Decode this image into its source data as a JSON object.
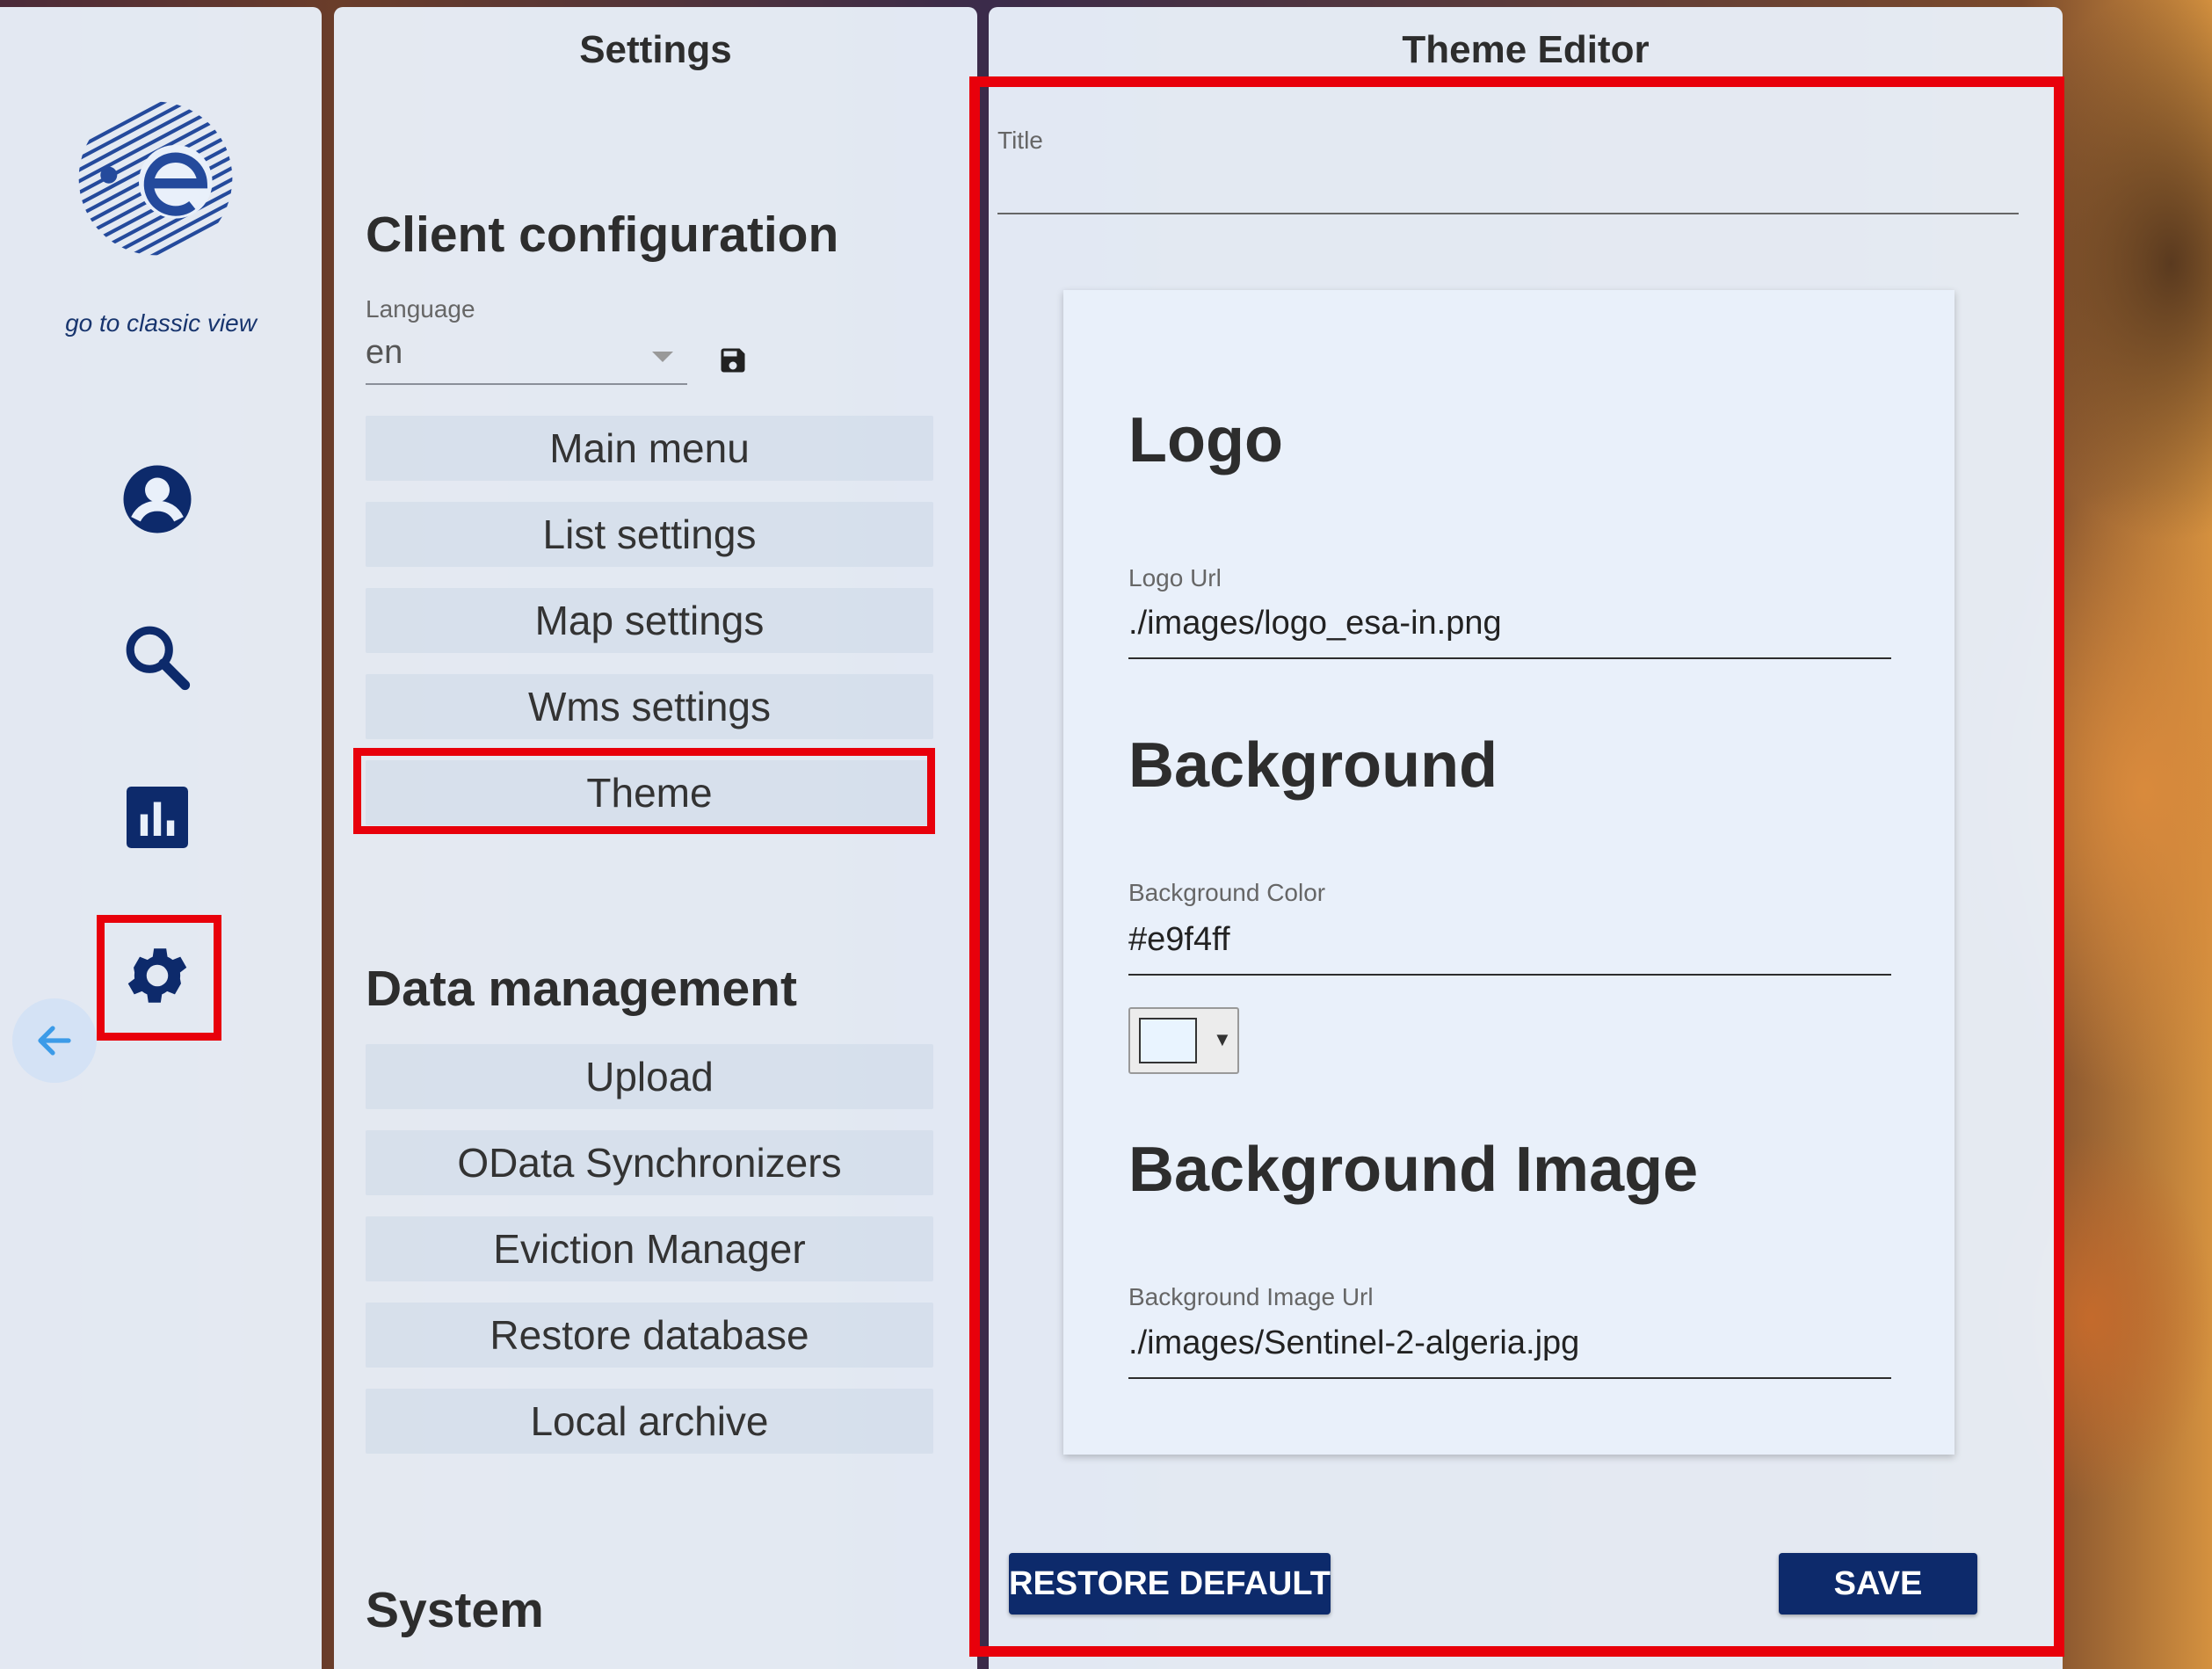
{
  "rail": {
    "classic_link": "go to classic view",
    "icons": [
      "esa-logo",
      "user-icon",
      "search-icon",
      "chart-icon",
      "gear-icon",
      "arrow-left-icon"
    ]
  },
  "settings": {
    "title": "Settings",
    "client_configuration": {
      "heading": "Client configuration",
      "language_label": "Language",
      "language_value": "en",
      "items": [
        "Main menu",
        "List settings",
        "Map settings",
        "Wms settings",
        "Theme"
      ],
      "selected": "Theme"
    },
    "data_management": {
      "heading": "Data management",
      "items": [
        "Upload",
        "OData Synchronizers",
        "Eviction Manager",
        "Restore database",
        "Local archive"
      ]
    },
    "system": {
      "heading": "System"
    }
  },
  "editor": {
    "title": "Theme Editor",
    "title_field": {
      "label": "Title",
      "value": ""
    },
    "logo": {
      "heading": "Logo",
      "url_label": "Logo Url",
      "url_value": "./images/logo_esa-in.png"
    },
    "background": {
      "heading": "Background",
      "color_label": "Background Color",
      "color_value": "#e9f4ff"
    },
    "background_image": {
      "heading": "Background Image",
      "url_label": "Background Image Url",
      "url_value": "./images/Sentinel-2-algeria.jpg"
    },
    "restore_label": "RESTORE DEFAULT",
    "save_label": "SAVE"
  },
  "colors": {
    "accent": "#0d2a6b",
    "highlight": "#e8000b",
    "panel": "#e9f0fa"
  }
}
